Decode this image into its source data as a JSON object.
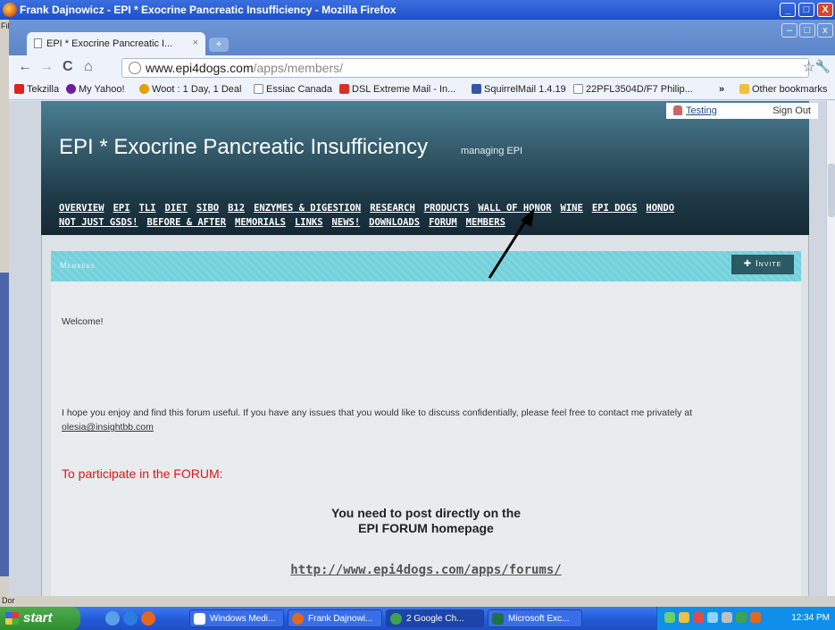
{
  "firefox": {
    "title": "Frank Dajnowicz - EPI * Exocrine Pancreatic Insufficiency - Mozilla Firefox",
    "menu_fragment": "File",
    "status_fragment": "Dor"
  },
  "chrome": {
    "tab_title": "EPI * Exocrine Pancreatic I...",
    "tab_close": "×",
    "new_tab": "+",
    "url_host": "www.epi4dogs.com",
    "url_path": "/apps/members/",
    "bookmarks": [
      {
        "label": "Tekzilla",
        "color": "#d9251c"
      },
      {
        "label": "My Yahoo!",
        "color": "#6b1d9b"
      },
      {
        "label": "Woot : 1 Day, 1 Deal",
        "color": "#e3a000"
      },
      {
        "label": "Essiac Canada",
        "color": "#ffffff"
      },
      {
        "label": "DSL Extreme Mail - In...",
        "color": "#d93025"
      },
      {
        "label": "SquirrelMail 1.4.19",
        "color": "#3355aa"
      },
      {
        "label": "22PFL3504D/F7 Philip...",
        "color": "#ffffff"
      }
    ],
    "bookmarks_overflow": "»",
    "other_bookmarks": "Other bookmarks"
  },
  "site": {
    "user": "Testing",
    "sign_out": "Sign Out",
    "title": "EPI * Exocrine Pancreatic Insufficiency",
    "subtitle": "managing EPI",
    "nav_row1": [
      "OVERVIEW",
      "EPI",
      "TLI",
      "DIET",
      "SIBO",
      "B12",
      "ENZYMES & DIGESTION",
      "RESEARCH",
      "PRODUCTS",
      "WALL OF HONOR",
      "WINE",
      "EPI DOGS",
      "HONDO"
    ],
    "nav_row2": [
      "NOT JUST GSDS!",
      "BEFORE & AFTER",
      "MEMORIALS",
      "LINKS",
      "NEWS!",
      "DOWNLOADS",
      "FORUM",
      "MEMBERS"
    ]
  },
  "members": {
    "heading": "Members",
    "invite": "Invite",
    "welcome": "Welcome!",
    "body": "I hope you enjoy and find this forum useful. If you have any issues that you would like to discuss confidentially, please feel free to contact me privately at",
    "email": "olesia@insightbb.com",
    "participate": "To participate in the FORUM:",
    "post_line1": "You need to post directly on the",
    "post_line2": "EPI FORUM homepage",
    "forum_url": "http://www.epi4dogs.com/apps/forums/"
  },
  "taskbar": {
    "start": "start",
    "tasks": [
      {
        "label": "Windows Medi...",
        "color": "#ffffff"
      },
      {
        "label": "Frank Dajnowi...",
        "color": "#e2681d"
      },
      {
        "label": "2 Google Ch...",
        "color": "#3fa34d"
      },
      {
        "label": "Microsoft Exc...",
        "color": "#1e7145"
      }
    ],
    "clock": "12:34 PM"
  }
}
